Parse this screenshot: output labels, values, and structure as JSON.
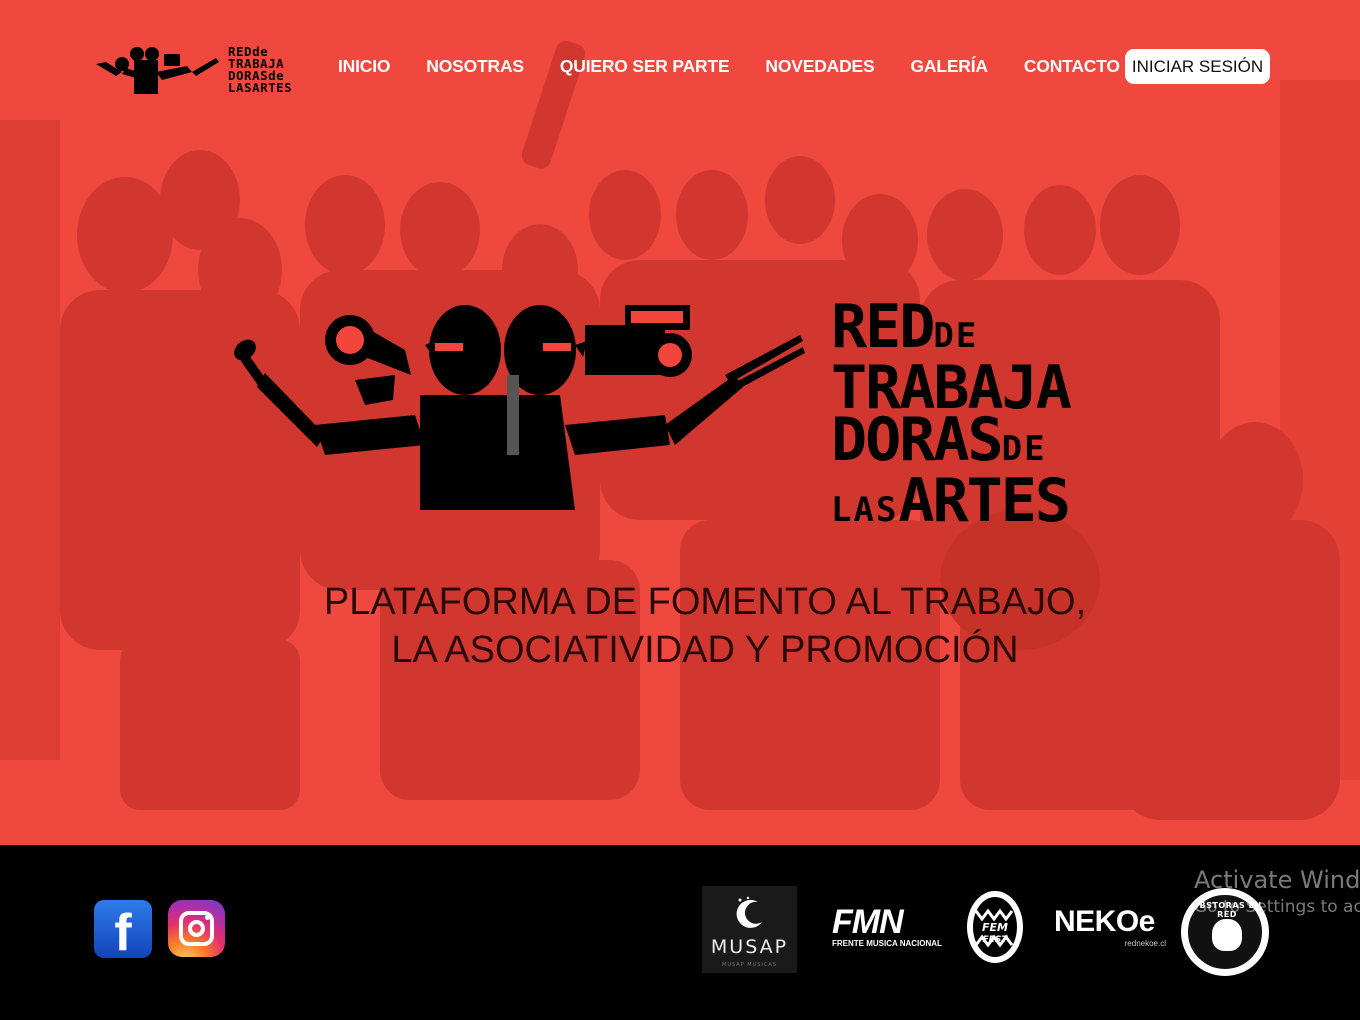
{
  "brand": {
    "title_lines": [
      "RED",
      "DE",
      "TRABAJA",
      "DORAS",
      "DE",
      "LAS",
      "ARTES"
    ],
    "small_logo_text": "REDde TRABAJA DORASde LASARTES",
    "accent_color": "#f2463c"
  },
  "nav": {
    "items": [
      "INICIO",
      "NOSOTRAS",
      "QUIERO SER PARTE",
      "NOVEDADES",
      "GALERÍA",
      "CONTACTO"
    ],
    "login_label": "INICIAR SESIÓN"
  },
  "hero": {
    "tagline_line1": "PLATAFORMA DE FOMENTO AL TRABAJO,",
    "tagline_line2": "LA ASOCIATIVIDAD Y PROMOCIÓN"
  },
  "footer": {
    "social": [
      {
        "name": "facebook",
        "icon": "facebook-icon",
        "glyph": "f"
      },
      {
        "name": "instagram",
        "icon": "instagram-icon"
      }
    ],
    "partners": {
      "musap": {
        "name": "MUSAP",
        "sub": "MUSAP MUSICAS"
      },
      "fmn": {
        "name": "FMN",
        "sub": "FRENTE MUSICA NACIONAL"
      },
      "femfest": {
        "name": "FEM FEST"
      },
      "nekoe": {
        "name": "NEKOe",
        "sub": "rednekoe.cl"
      },
      "obs": {
        "name": "OBSTORAS EN RED"
      }
    },
    "watermark_line1": "Activate Windows",
    "watermark_line2": "Go to Settings to activate Windows."
  }
}
